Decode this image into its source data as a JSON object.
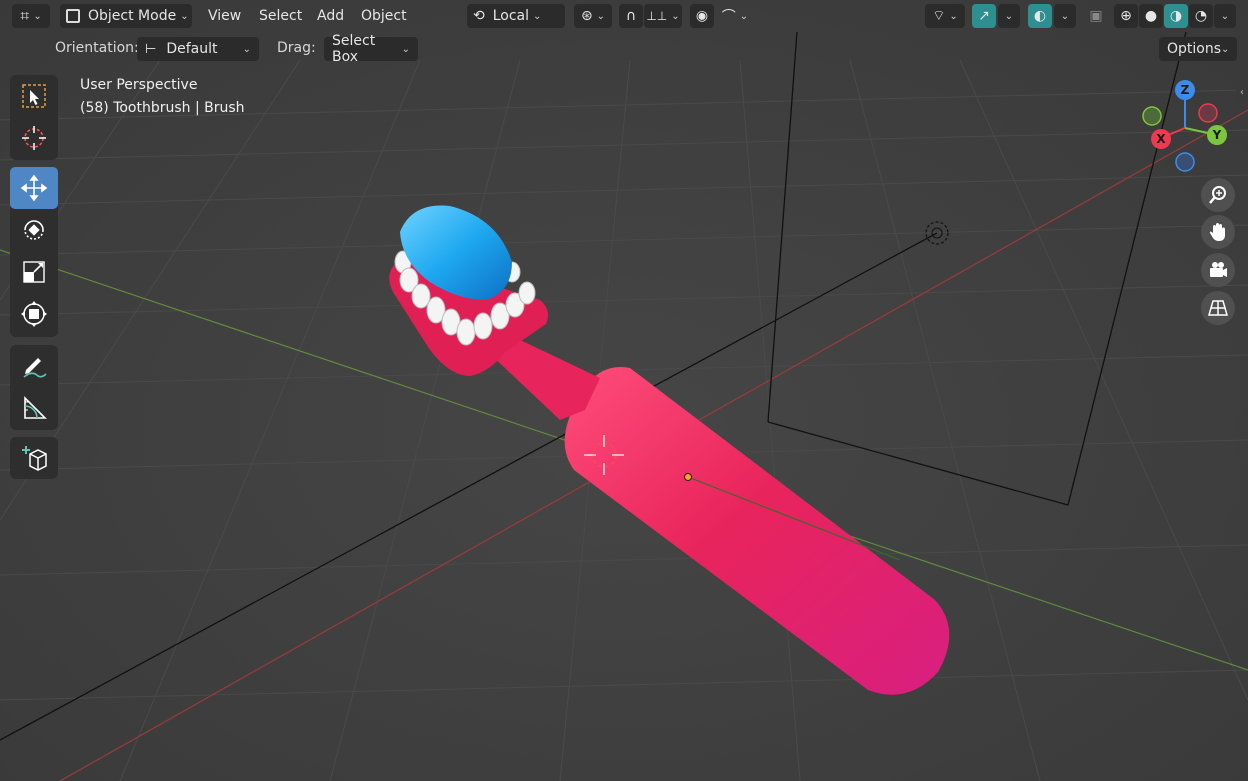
{
  "header": {
    "mode_label": "Object Mode",
    "menu": [
      "View",
      "Select",
      "Add",
      "Object"
    ],
    "pivot_label": "Local",
    "options_label": "Options"
  },
  "tool_settings": {
    "orientation_label": "Orientation:",
    "orientation_value": "Default",
    "drag_label": "Drag:",
    "drag_value": "Select Box"
  },
  "viewport": {
    "view_name": "User Perspective",
    "object_info": "(58) Toothbrush | Brush"
  },
  "gizmo": {
    "x_label": "X",
    "y_label": "Y",
    "z_label": "Z"
  },
  "toolbar": {
    "tools": [
      "select-box",
      "cursor",
      "move",
      "rotate",
      "scale",
      "transform",
      "annotate",
      "measure",
      "add-cube"
    ],
    "active_tool": "move"
  },
  "colors": {
    "viewport_bg": "#3d3d3d",
    "toothbrush_handle": "#e8245c",
    "toothpaste": "#1ea8f0",
    "active_tool": "#4f86c6",
    "axis_x": "#f0384f",
    "axis_y": "#7cc63c",
    "axis_z": "#3c8cf0"
  }
}
